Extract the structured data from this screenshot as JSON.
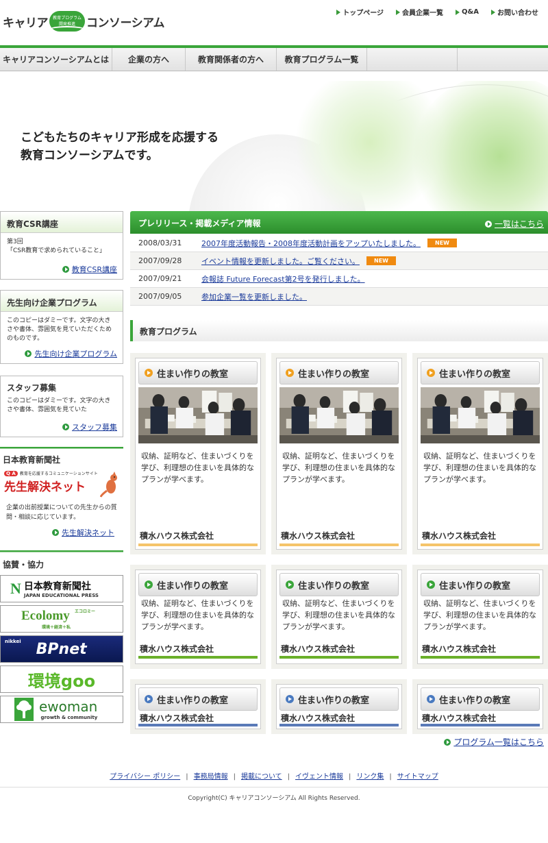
{
  "header": {
    "logo_left": "キャリア",
    "logo_badge_line1": "教育プログラム",
    "logo_badge_line2": "開発推進",
    "logo_right": "コンソーシアム",
    "topnav": [
      "トップページ",
      "会員企業一覧",
      "Q&A",
      "お問い合わせ"
    ]
  },
  "mainnav": [
    "キャリアコンソーシアムとは",
    "企業の方へ",
    "教育関係者の方へ",
    "教育プログラム一覧"
  ],
  "hero": {
    "line1": "こどもたちのキャリア形成を応援する",
    "line2": "教育コンソーシアムです。"
  },
  "sidebar": {
    "csr": {
      "title": "教育CSR講座",
      "line1": "第3回",
      "line2": "「CSR教育で求められていること」",
      "link": "教育CSR講座"
    },
    "teacher": {
      "title": "先生向け企業プログラム",
      "body": "このコピーはダミーです。文字の大きさや書体、雰囲気を見ていただくためのものです。",
      "link": "先生向け企業プログラム"
    },
    "staff": {
      "title": "スタッフ募集",
      "body": "このコピーはダミーです。文字の大きさや書体、雰囲気を見ていた",
      "link": "スタッフ募集"
    },
    "newspaper": {
      "title": "日本教育新聞社",
      "logo_sub": "教育を応援するコミュニケーションサイト",
      "logo_main": "先生解決ネット",
      "body": "企業の出前授業についての先生からの質問・相談に応じています。",
      "link": "先生解決ネット"
    },
    "partners": {
      "title": "協賛・協力",
      "banners": [
        {
          "main": "日本教育新聞社",
          "sub": "JAPAN EDUCATIONAL PRESS"
        },
        {
          "main": "Ecolomy",
          "sub": "環境＋経済＋私",
          "kana": "エコロミー"
        },
        {
          "main": "BPnet",
          "sub": "nikkei"
        },
        {
          "main": "環境goo",
          "sub": ""
        },
        {
          "main": "ewoman",
          "sub": "growth & community"
        }
      ]
    }
  },
  "news": {
    "title": "プレリリース・掲載メディア情報",
    "more": "一覧はこちら",
    "items": [
      {
        "date": "2008/03/31",
        "text": "2007年度活動報告・2008年度活動計画をアップいたしました。",
        "badge": "NEW"
      },
      {
        "date": "2007/09/28",
        "text": "イベント情報を更新しました。ご覧ください。",
        "badge": "NEW"
      },
      {
        "date": "2007/09/21",
        "text": "会報誌 Future Forecast第2号を発行しました。",
        "badge": ""
      },
      {
        "date": "2007/09/05",
        "text": "参加企業一覧を更新しました。",
        "badge": ""
      }
    ]
  },
  "programs": {
    "title": "教育プログラム",
    "card_title": "住まい作りの教室",
    "card_desc": "収納、証明など、住まいづくりを学び、利理想の住まいを具体的なプランが学べます。",
    "card_company": "積水ハウス株式会社",
    "more": "プログラム一覧はこちら",
    "colors": {
      "orange": "#f5c46a",
      "green": "#6ab02a",
      "blue": "#5a7ab8"
    }
  },
  "footer": {
    "links": [
      "プライバシー ポリシー",
      "事務局情報",
      "掲載について",
      "イヴェント情報",
      "リンク集",
      "サイトマップ"
    ],
    "copyright": "Copyright(C) キャリアコンソーシアム All Rights Reserved."
  }
}
